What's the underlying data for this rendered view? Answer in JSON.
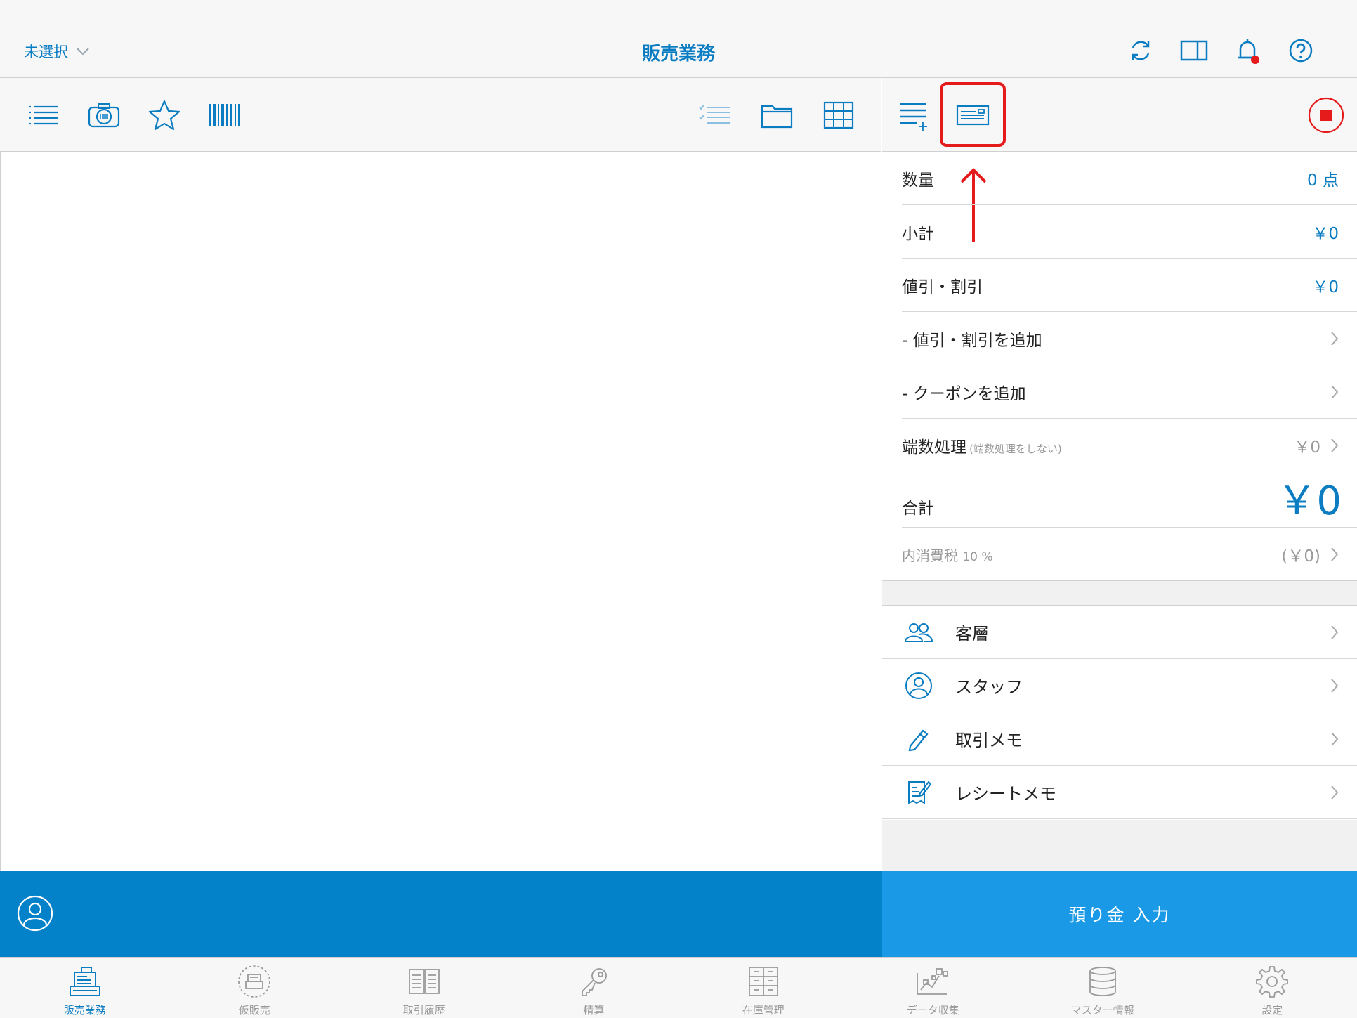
{
  "header": {
    "store_select": "未選択",
    "title": "販売業務"
  },
  "summary": {
    "quantity_label": "数量",
    "quantity_value": "0 点",
    "subtotal_label": "小計",
    "subtotal_value": "￥0",
    "discount_label": "値引・割引",
    "discount_value": "￥0",
    "add_discount_label": "- 値引・割引を追加",
    "add_coupon_label": "- クーポンを追加",
    "rounding_label": "端数処理",
    "rounding_note": "(端数処理をしない)",
    "rounding_value": "￥0",
    "total_label": "合計",
    "total_value": "￥0",
    "tax_label": "内消費税",
    "tax_rate": "10 %",
    "tax_value": "(￥0)"
  },
  "options": [
    {
      "label": "客層",
      "icon": "customer-group-icon"
    },
    {
      "label": "スタッフ",
      "icon": "staff-icon"
    },
    {
      "label": "取引メモ",
      "icon": "pencil-icon"
    },
    {
      "label": "レシートメモ",
      "icon": "receipt-memo-icon"
    }
  ],
  "deposit_button": "預り金 入力",
  "tabs": [
    {
      "label": "販売業務",
      "icon": "register-icon",
      "active": true
    },
    {
      "label": "仮販売",
      "icon": "temp-sale-icon"
    },
    {
      "label": "取引履歴",
      "icon": "history-book-icon"
    },
    {
      "label": "精算",
      "icon": "key-icon"
    },
    {
      "label": "在庫管理",
      "icon": "inventory-icon"
    },
    {
      "label": "データ収集",
      "icon": "data-collection-icon"
    },
    {
      "label": "マスター情報",
      "icon": "database-icon"
    },
    {
      "label": "設定",
      "icon": "gear-icon"
    }
  ],
  "colors": {
    "accent": "#0a7cc2",
    "customer_bar": "#0381c9",
    "deposit_button": "#1a9ae6",
    "highlight": "#e51b1b"
  }
}
